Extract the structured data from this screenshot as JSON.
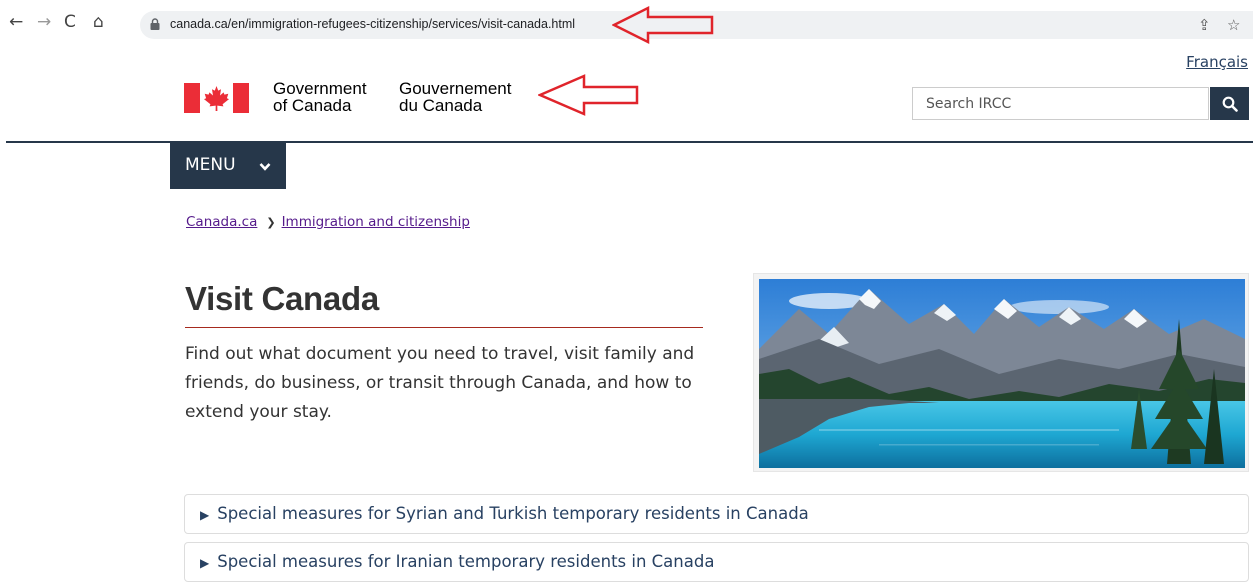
{
  "browser": {
    "url": "canada.ca/en/immigration-refugees-citizenship/services/visit-canada.html"
  },
  "header": {
    "language_link": "Français",
    "signature_en_line1": "Government",
    "signature_en_line2": "of Canada",
    "signature_fr_line1": "Gouvernement",
    "signature_fr_line2": "du Canada",
    "search_placeholder": "Search IRCC",
    "menu_label": "MENU"
  },
  "breadcrumb": [
    "Canada.ca",
    "Immigration and citizenship"
  ],
  "main": {
    "title": "Visit Canada",
    "lead": "Find out what document you need to travel, visit family and friends, do business, or transit through Canada, and how to extend your stay.",
    "details": [
      "Special measures for Syrian and Turkish temporary residents in Canada",
      "Special measures for Iranian temporary residents in Canada"
    ]
  },
  "colors": {
    "gc_navy": "#26374a",
    "flag_red": "#eb2d37",
    "annotation_arrow": "#e0242b"
  },
  "icons": [
    "back-arrow-icon",
    "forward-arrow-icon",
    "reload-icon",
    "home-icon",
    "lock-icon",
    "share-icon",
    "star-icon",
    "search-icon",
    "chevron-down-icon",
    "expand-triangle-icon"
  ]
}
